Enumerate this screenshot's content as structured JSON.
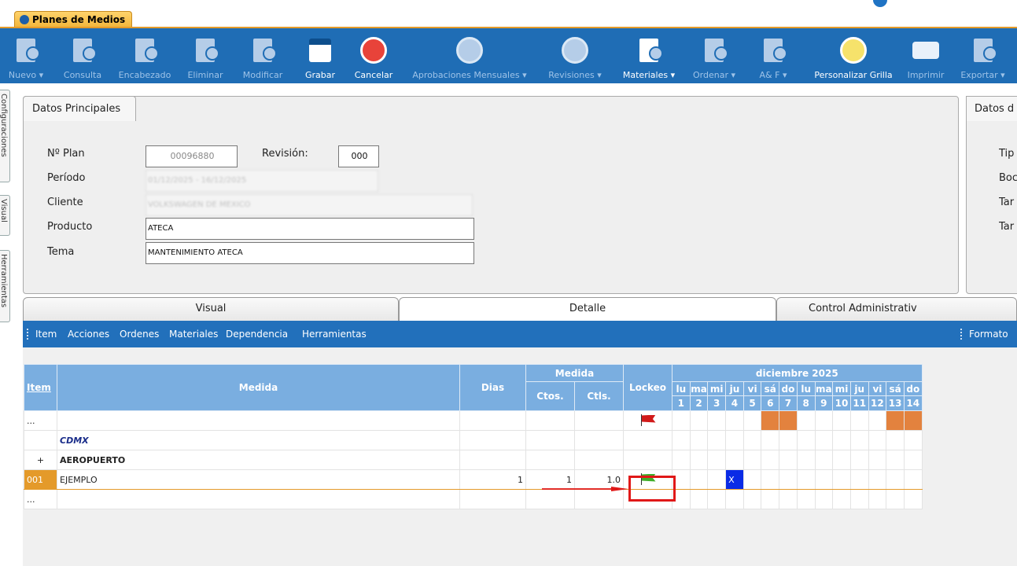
{
  "tab": {
    "title": "Planes de Medios"
  },
  "toolbar": {
    "buttons": [
      {
        "label": "Nuevo ▾",
        "icon": "new-doc-icon",
        "active": false
      },
      {
        "label": "Consulta",
        "icon": "query-doc-icon",
        "active": false
      },
      {
        "label": "Encabezado",
        "icon": "edit-doc-icon",
        "active": false
      },
      {
        "label": "Eliminar",
        "icon": "delete-doc-icon",
        "active": false
      },
      {
        "label": "Modificar",
        "icon": "modify-doc-icon",
        "active": false
      },
      {
        "label": "Grabar",
        "icon": "save-icon",
        "active": true
      },
      {
        "label": "Cancelar",
        "icon": "cancel-icon",
        "active": true
      },
      {
        "label": "Aprobaciones Mensuales ▾",
        "icon": "thumbs-up-icon",
        "active": false
      },
      {
        "label": "Revisiones ▾",
        "icon": "thumbs-up-icon",
        "active": false
      },
      {
        "label": "Materiales ▾",
        "icon": "materials-icon",
        "active": true
      },
      {
        "label": "Ordenar ▾",
        "icon": "order-doc-icon",
        "active": false
      },
      {
        "label": "A& F ▾",
        "icon": "af-doc-icon",
        "active": false
      },
      {
        "label": "Personalizar Grilla",
        "icon": "grid-icon",
        "active": true
      },
      {
        "label": "Imprimir",
        "icon": "printer-icon",
        "active": false
      },
      {
        "label": "Exportar ▾",
        "icon": "export-icon",
        "active": false
      }
    ]
  },
  "side_tabs": [
    "Configuraciones",
    "Visual",
    "Herramientas"
  ],
  "datos": {
    "tab_label": "Datos Principales",
    "plan_label": "Nº Plan",
    "plan_value": "00096880",
    "revision_label": "Revisión:",
    "revision_value": "000",
    "periodo_label": "Período",
    "periodo_value": "01/12/2025 - 16/12/2025",
    "cliente_label": "Cliente",
    "cliente_value": "VOLKSWAGEN DE MEXICO",
    "producto_label": "Producto",
    "producto_value": "ATECA",
    "tema_label": "Tema",
    "tema_value": "MANTENIMIENTO ATECA"
  },
  "datos_right": {
    "tab_label": "Datos d",
    "labels": [
      "Tip",
      "Boc",
      "Tar",
      "Tar"
    ]
  },
  "section_tabs": [
    "Visual",
    "Detalle",
    "Control Administrativ"
  ],
  "menubar": {
    "items": [
      "Item",
      "Acciones",
      "Ordenes",
      "Materiales",
      "Dependencia",
      "Herramientas"
    ],
    "right": "Formato"
  },
  "grid": {
    "headers": {
      "item": "Item",
      "medida": "Medida",
      "dias": "Dias",
      "medida_group": "Medida",
      "ctos": "Ctos.",
      "ctls": "Ctls.",
      "lockeo": "Lockeo",
      "month": "diciembre 2025"
    },
    "days": [
      {
        "dow": "lu",
        "num": "1"
      },
      {
        "dow": "ma",
        "num": "2"
      },
      {
        "dow": "mi",
        "num": "3"
      },
      {
        "dow": "ju",
        "num": "4"
      },
      {
        "dow": "vi",
        "num": "5"
      },
      {
        "dow": "sá",
        "num": "6"
      },
      {
        "dow": "do",
        "num": "7"
      },
      {
        "dow": "lu",
        "num": "8"
      },
      {
        "dow": "ma",
        "num": "9"
      },
      {
        "dow": "mi",
        "num": "10"
      },
      {
        "dow": "ju",
        "num": "11"
      },
      {
        "dow": "vi",
        "num": "12"
      },
      {
        "dow": "sá",
        "num": "13"
      },
      {
        "dow": "do",
        "num": "14"
      }
    ],
    "rows": [
      {
        "item": "...",
        "medida": "",
        "dias": "",
        "ctos": "",
        "ctls": "",
        "lock": "red"
      },
      {
        "item": "",
        "medida": "CDMX",
        "dias": "",
        "ctos": "",
        "ctls": "",
        "lock": ""
      },
      {
        "item": "+",
        "medida": "AEROPUERTO",
        "dias": "",
        "ctos": "",
        "ctls": "",
        "lock": ""
      },
      {
        "item": "001",
        "medida": "EJEMPLO",
        "dias": "1",
        "ctos": "1",
        "ctls": "1.0",
        "lock": "green",
        "mark_day": "4",
        "mark": "X"
      },
      {
        "item": "...",
        "medida": "",
        "dias": "",
        "ctos": "",
        "ctls": "",
        "lock": ""
      }
    ]
  },
  "colors": {
    "toolbar": "#1f6db5",
    "header": "#7aaee0",
    "weekend": "#e3823e",
    "highlight": "#e01818",
    "tab": "#f2b53a"
  }
}
